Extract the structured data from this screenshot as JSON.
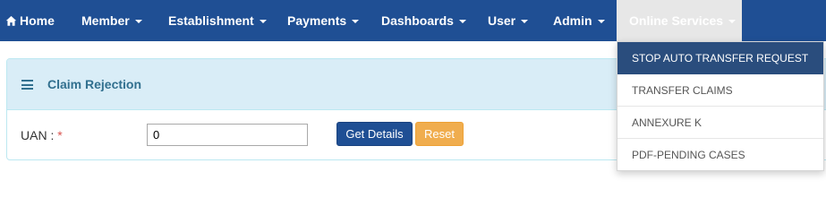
{
  "nav": {
    "home": "Home",
    "member": "Member",
    "establishment": "Establishment",
    "payments": "Payments",
    "dashboards": "Dashboards",
    "user": "User",
    "admin": "Admin",
    "online_services": "Online Services"
  },
  "panel": {
    "title": "Claim Rejection"
  },
  "form": {
    "uan_label": "UAN :",
    "required_mark": "*",
    "uan_value": "0",
    "get_details": "Get Details",
    "reset": "Reset"
  },
  "dropdown": {
    "items": [
      "STOP AUTO TRANSFER REQUEST",
      "TRANSFER CLAIMS",
      "ANNEXURE K",
      "PDF-PENDING CASES"
    ]
  },
  "colors": {
    "navbar": "#1f4f94",
    "panel_heading": "#d9edf7",
    "panel_title": "#31708f",
    "btn_primary": "#1f4f94",
    "btn_warning": "#f0ad4e",
    "dropdown_active": "#2a4d7d"
  },
  "icons": {
    "home": "home-icon",
    "menu": "hamburger-menu-icon",
    "caret": "caret-down-icon"
  }
}
